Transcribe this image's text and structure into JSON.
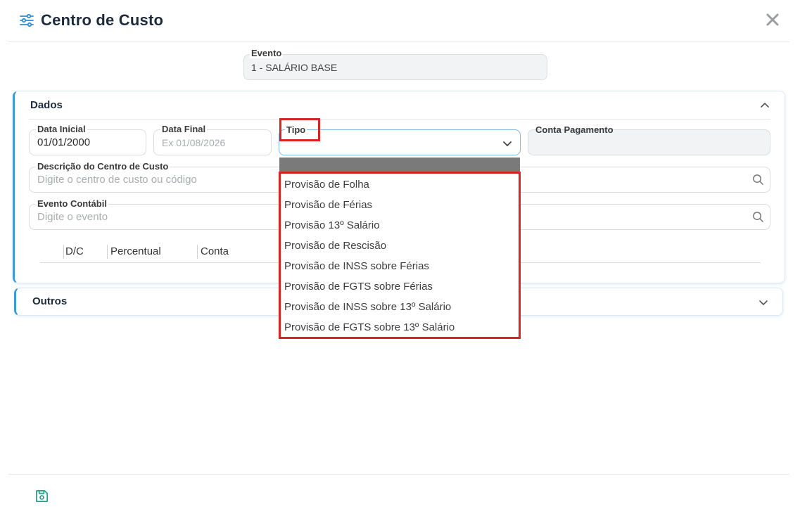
{
  "header": {
    "title": "Centro de Custo",
    "icon": "sliders-icon",
    "close_icon": "close-icon"
  },
  "evento": {
    "label": "Evento",
    "value": "1 - SALÁRIO BASE"
  },
  "dados": {
    "title": "Dados",
    "data_inicial": {
      "label": "Data Inicial",
      "value": "01/01/2000"
    },
    "data_final": {
      "label": "Data Final",
      "placeholder": "Ex 01/08/2026"
    },
    "tipo": {
      "label": "Tipo",
      "value": ""
    },
    "conta_pagamento": {
      "label": "Conta Pagamento",
      "value": ""
    },
    "descricao": {
      "label": "Descrição do Centro de Custo",
      "placeholder": "Digite o centro de custo ou código"
    },
    "evento_contabil": {
      "label": "Evento Contábil",
      "placeholder": "Digite o evento"
    },
    "table_headers": [
      "D/C",
      "Percentual",
      "Conta"
    ]
  },
  "tipo_options": [
    "Provisão de Folha",
    "Provisão de Férias",
    "Provisão 13º Salário",
    "Provisão de Rescisão",
    "Provisão de INSS sobre Férias",
    "Provisão de FGTS sobre Férias",
    "Provisão de INSS sobre 13º Salário",
    "Provisão de FGTS sobre 13º Salário"
  ],
  "outros": {
    "title": "Outros"
  },
  "footer": {
    "save_icon": "save-icon"
  },
  "colors": {
    "accent": "#3a9bd8",
    "teal": "#1aa589",
    "highlight": "#d62424"
  }
}
